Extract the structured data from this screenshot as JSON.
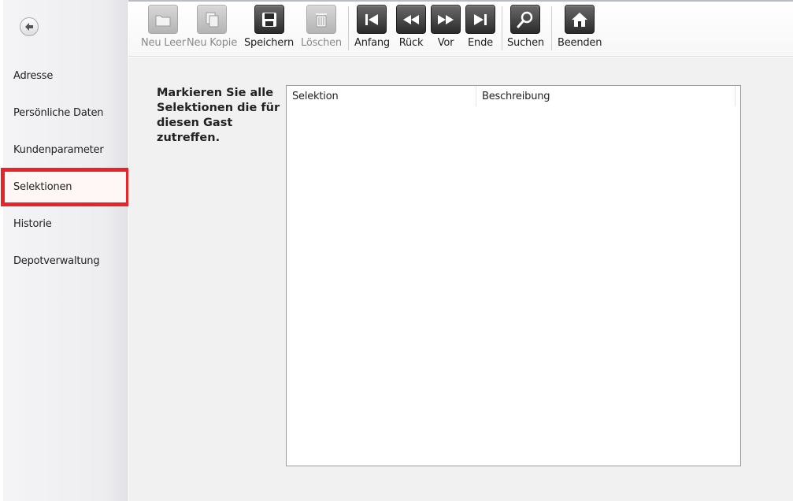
{
  "sidebar": {
    "back_icon": "arrow-left-circle-icon",
    "items": [
      {
        "label": "Adresse",
        "active": false
      },
      {
        "label": "Persönliche Daten",
        "active": false
      },
      {
        "label": "Kundenparameter",
        "active": false
      },
      {
        "label": "Selektionen",
        "active": true
      },
      {
        "label": "Historie",
        "active": false
      },
      {
        "label": "Depotverwaltung",
        "active": false
      }
    ]
  },
  "toolbar": {
    "buttons": [
      {
        "label": "Neu Leer",
        "icon": "new-folder-icon",
        "enabled": false
      },
      {
        "label": "Neu Kopie",
        "icon": "copy-document-icon",
        "enabled": false
      },
      {
        "label": "Speichern",
        "icon": "save-icon",
        "enabled": true
      },
      {
        "label": "Löschen",
        "icon": "trash-icon",
        "enabled": false
      },
      {
        "label": "Anfang",
        "icon": "first-record-icon",
        "enabled": true
      },
      {
        "label": "Rück",
        "icon": "previous-icon",
        "enabled": true
      },
      {
        "label": "Vor",
        "icon": "next-icon",
        "enabled": true
      },
      {
        "label": "Ende",
        "icon": "last-record-icon",
        "enabled": true
      },
      {
        "label": "Suchen",
        "icon": "search-icon",
        "enabled": true
      },
      {
        "label": "Beenden",
        "icon": "home-icon",
        "enabled": true
      }
    ]
  },
  "main": {
    "instruction": "Markieren Sie alle Selektionen die für diesen Gast zutreffen.",
    "grid": {
      "columns": [
        "Selektion",
        "Beschreibung"
      ],
      "rows": []
    }
  },
  "colors": {
    "highlight_border": "#e8232a",
    "icon_dark": "#2a2a2a",
    "icon_disabled": "#b4b4b4"
  }
}
